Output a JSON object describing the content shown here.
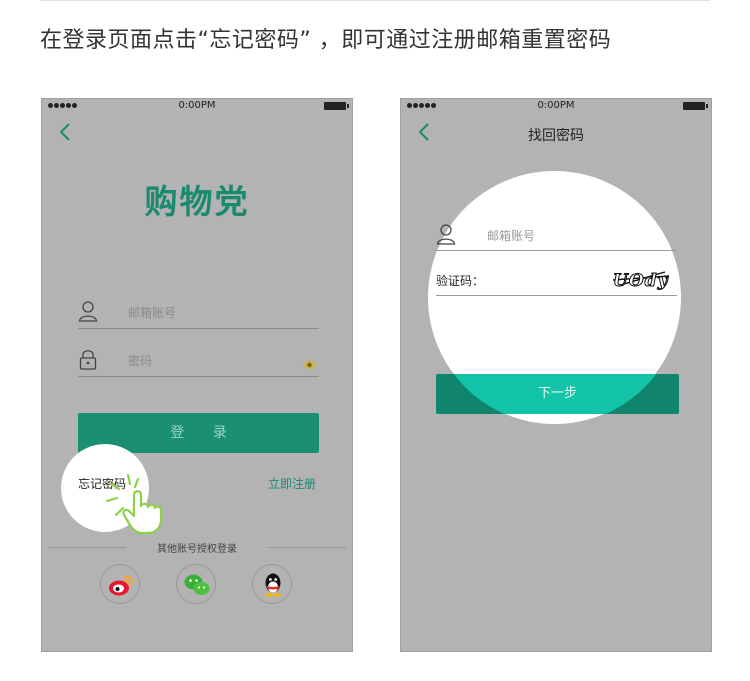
{
  "headline": "在登录页面点击“忘记密码” ，即可通过注册邮箱重置密码",
  "colors": {
    "page_bg": "#ffffff",
    "phone_bg": "#b3b3b3",
    "brand_green": "#1a8a6f",
    "button_green": "#1a8f74",
    "highlight_teal": "#13c4a8",
    "pointer_green": "#8bd14a"
  },
  "left_screen": {
    "status_bar": {
      "time": "0:00PM"
    },
    "logo": "购物党",
    "email_field": {
      "placeholder": "邮箱账号",
      "icon": "user-icon"
    },
    "password_field": {
      "placeholder": "密码",
      "icon": "lock-icon",
      "toggle_icon": "eye-icon"
    },
    "login_button": "登 录",
    "forgot_password": "忘记密码",
    "register_link": "立即注册",
    "other_login_label": "其他账号授权登录",
    "social": [
      "weibo-icon",
      "wechat-icon",
      "qq-icon"
    ]
  },
  "right_screen": {
    "status_bar": {
      "time": "0:00PM"
    },
    "title": "找回密码",
    "email_field": {
      "placeholder": "邮箱账号",
      "icon": "user-icon"
    },
    "captcha_field": {
      "label": "验证码：",
      "captcha_text": "UOdy"
    },
    "next_button": "下一步"
  }
}
